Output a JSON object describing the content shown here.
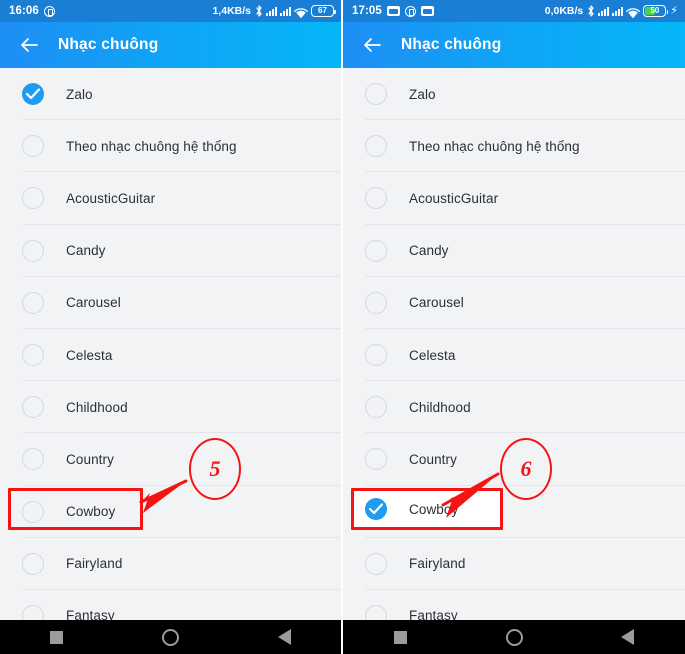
{
  "panels": [
    {
      "id": "before",
      "statusbar": {
        "time": "16:06",
        "net_speed": "1,4KB/s",
        "battery_level": "67",
        "battery_charging": false,
        "icons_left": [
          "camera-circle-icon"
        ],
        "icons_right": [
          "bluetooth-icon",
          "signal-icon",
          "signal-icon",
          "wifi-icon",
          "battery-icon"
        ]
      },
      "appbar": {
        "back_label": "back-arrow-icon",
        "title": "Nhạc chuông"
      },
      "items": [
        {
          "label": "Zalo",
          "selected": true
        },
        {
          "label": "Theo nhạc chuông hệ thống",
          "selected": false
        },
        {
          "label": "AcousticGuitar",
          "selected": false
        },
        {
          "label": "Candy",
          "selected": false
        },
        {
          "label": "Carousel",
          "selected": false
        },
        {
          "label": "Celesta",
          "selected": false
        },
        {
          "label": "Childhood",
          "selected": false
        },
        {
          "label": "Country",
          "selected": false
        },
        {
          "label": "Cowboy",
          "selected": false
        },
        {
          "label": "Fairyland",
          "selected": false
        },
        {
          "label": "Fantasy",
          "selected": false
        }
      ],
      "annotation": {
        "step_number": "5",
        "highlighted_item": "Cowboy"
      }
    },
    {
      "id": "after",
      "statusbar": {
        "time": "17:05",
        "net_speed": "0,0KB/s",
        "battery_level": "50",
        "battery_charging": true,
        "icons_left": [
          "notification-icon",
          "camera-circle-icon",
          "notification-icon"
        ],
        "icons_right": [
          "bluetooth-icon",
          "signal-icon",
          "signal-icon",
          "wifi-icon",
          "battery-icon",
          "charging-bolt-icon"
        ]
      },
      "appbar": {
        "back_label": "back-arrow-icon",
        "title": "Nhạc chuông"
      },
      "items": [
        {
          "label": "Zalo",
          "selected": false
        },
        {
          "label": "Theo nhạc chuông hệ thống",
          "selected": false
        },
        {
          "label": "AcousticGuitar",
          "selected": false
        },
        {
          "label": "Candy",
          "selected": false
        },
        {
          "label": "Carousel",
          "selected": false
        },
        {
          "label": "Celesta",
          "selected": false
        },
        {
          "label": "Childhood",
          "selected": false
        },
        {
          "label": "Country",
          "selected": false
        },
        {
          "label": "Cowboy",
          "selected": true
        },
        {
          "label": "Fairyland",
          "selected": false
        },
        {
          "label": "Fantasy",
          "selected": false
        }
      ],
      "annotation": {
        "step_number": "6",
        "highlighted_item": "Cowboy"
      }
    }
  ],
  "navbar": {
    "recents_label": "recents-square-icon",
    "home_label": "home-circle-icon",
    "back_label": "back-triangle-icon"
  },
  "colors": {
    "accent": "#1e9cf0",
    "appbar_start": "#1e8ef5",
    "appbar_end": "#05b6f8",
    "statusbar": "#1a7fd4",
    "annotation_red": "#f41414",
    "background": "#f2f3f5",
    "battery_fill": "#46d44a"
  }
}
